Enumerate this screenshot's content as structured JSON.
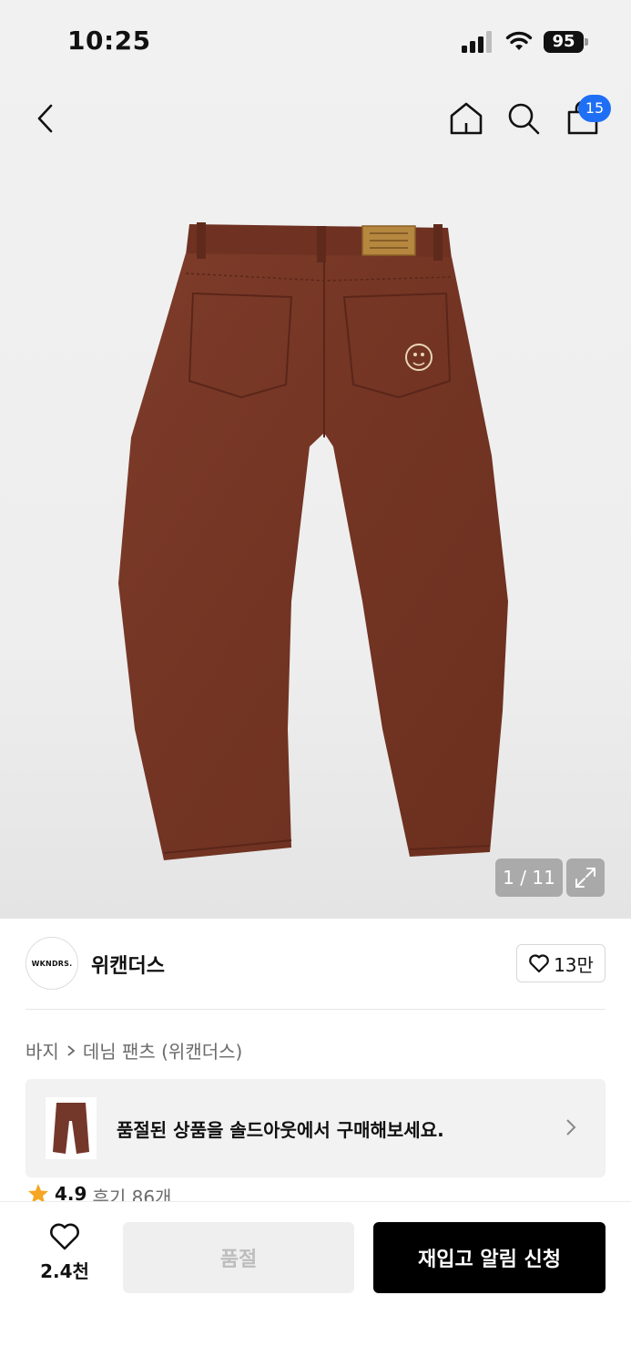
{
  "status_bar": {
    "time": "10:25",
    "battery": "95"
  },
  "nav": {
    "cart_count": "15",
    "icons": [
      "back-icon",
      "home-icon",
      "search-icon",
      "shopping-bag-icon"
    ]
  },
  "gallery": {
    "counter": "1 / 11"
  },
  "brand": {
    "logo_text": "WKNDRS.",
    "name": "위캔더스",
    "like_count": "13만"
  },
  "breadcrumb": {
    "category": "바지",
    "subcategory": "데님 팬츠 (위캔더스)"
  },
  "soldout_banner": {
    "text": "품절된 상품을 솔드아웃에서 구매해보세요."
  },
  "rating": {
    "value": "4.9",
    "reviews": "후기 86개"
  },
  "bottom_bar": {
    "wish_count": "2.4천",
    "soldout_label": "품절",
    "restock_label": "재입고 알림 신청"
  },
  "colors": {
    "badge": "#1f6ff5",
    "primary_button": "#000000",
    "star": "#f5a623",
    "product": "#7a3a28"
  }
}
